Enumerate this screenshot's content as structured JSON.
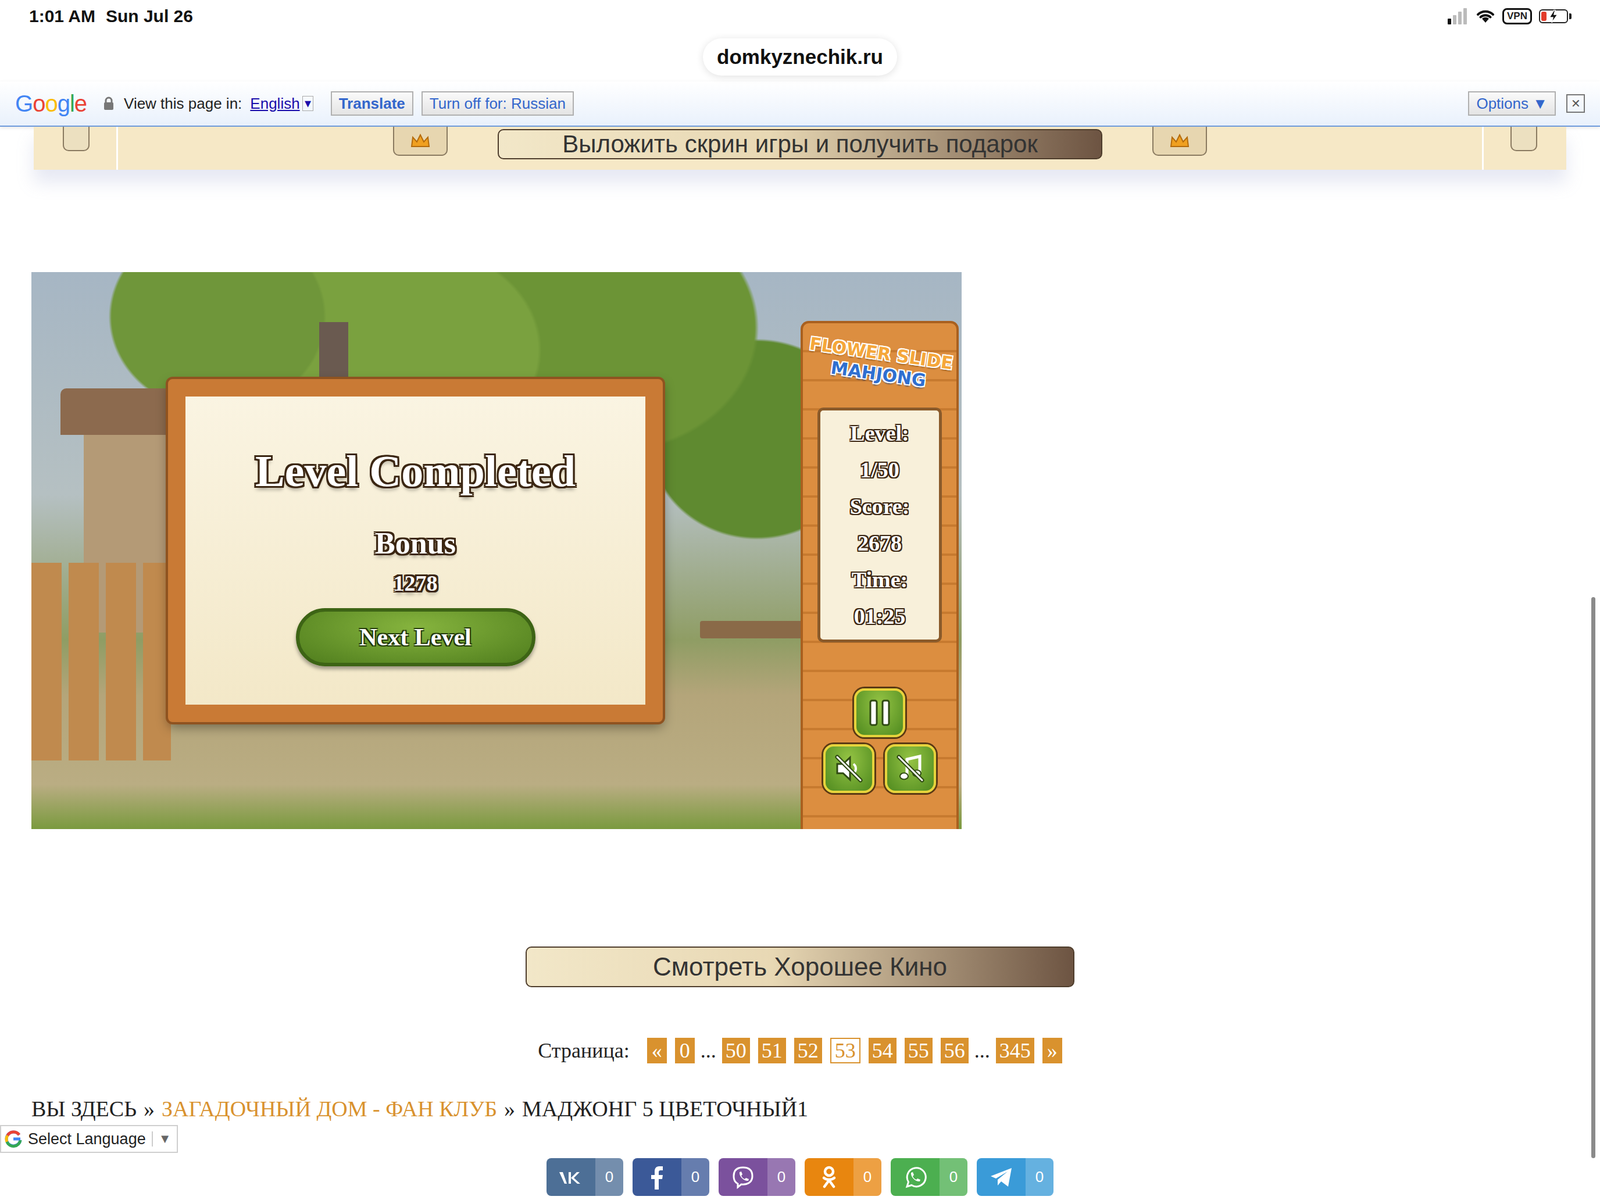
{
  "status_bar": {
    "time": "1:01 AM",
    "date": "Sun Jul 26",
    "signal_level": 0.25,
    "vpn": "VPN",
    "battery": {
      "level": 0.2,
      "charging": true
    }
  },
  "address_bar": {
    "url": "domkyznechik.ru"
  },
  "translate_bar": {
    "logo": "Google",
    "prompt": "View this page in:",
    "language": "English",
    "language_arrow": "▾",
    "translate_button": "Translate",
    "turn_off_button": "Turn off for: Russian",
    "options_button": "Options ▼",
    "close": "✕"
  },
  "banner": {
    "button": "Выложить скрин игры и получить подарок"
  },
  "game": {
    "logo": [
      "FLOWER SLIDE",
      "MAHJONG"
    ],
    "dialog": {
      "title": "Level Completed",
      "bonus_label": "Bonus",
      "bonus": "1278",
      "button": "Next Level"
    },
    "stats": [
      {
        "label": "Level:",
        "value": "1/50"
      },
      {
        "label": "Score:",
        "value": "2678"
      },
      {
        "label": "Time:",
        "value": "01:25"
      }
    ],
    "controls": [
      {
        "kind": "pause",
        "muted": false
      },
      {
        "kind": "sound",
        "muted": true
      },
      {
        "kind": "music",
        "muted": true
      }
    ]
  },
  "movie_button": "Смотреть Хорошее Кино",
  "pagination": {
    "label": "Страница:",
    "items": [
      {
        "label": "«",
        "kind": "link",
        "selected": false
      },
      {
        "label": "0",
        "kind": "link",
        "selected": false
      },
      {
        "label": "...",
        "kind": "ellipsis",
        "selected": false
      },
      {
        "label": "50",
        "kind": "link",
        "selected": false
      },
      {
        "label": "51",
        "kind": "link",
        "selected": false
      },
      {
        "label": "52",
        "kind": "link",
        "selected": false
      },
      {
        "label": "53",
        "kind": "link",
        "selected": true
      },
      {
        "label": "54",
        "kind": "link",
        "selected": false
      },
      {
        "label": "55",
        "kind": "link",
        "selected": false
      },
      {
        "label": "56",
        "kind": "link",
        "selected": false
      },
      {
        "label": "...",
        "kind": "ellipsis",
        "selected": false
      },
      {
        "label": "345",
        "kind": "link",
        "selected": false
      },
      {
        "label": "»",
        "kind": "link",
        "selected": false
      }
    ]
  },
  "breadcrumb": {
    "separator": "»",
    "items": [
      {
        "label": "ВЫ ЗДЕСЬ",
        "kind": "text"
      },
      {
        "label": "ЗАГАДОЧНЫЙ ДОМ - ФАН КЛУБ",
        "kind": "link"
      },
      {
        "label": "МАДЖОНГ 5 ЦВЕТОЧНЫЙ1",
        "kind": "text"
      }
    ]
  },
  "language_select": {
    "label": "Select Language",
    "arrow": "▼"
  },
  "share": [
    {
      "kind": "vk",
      "count": "0",
      "color": "#4d6f96"
    },
    {
      "kind": "facebook",
      "count": "0",
      "color": "#3b5998"
    },
    {
      "kind": "viber",
      "count": "0",
      "color": "#7b519d"
    },
    {
      "kind": "odnoklassniki",
      "count": "0",
      "color": "#e8860f"
    },
    {
      "kind": "whatsapp",
      "count": "0",
      "color": "#4caf50"
    },
    {
      "kind": "telegram",
      "count": "0",
      "color": "#3a9bd8"
    }
  ]
}
